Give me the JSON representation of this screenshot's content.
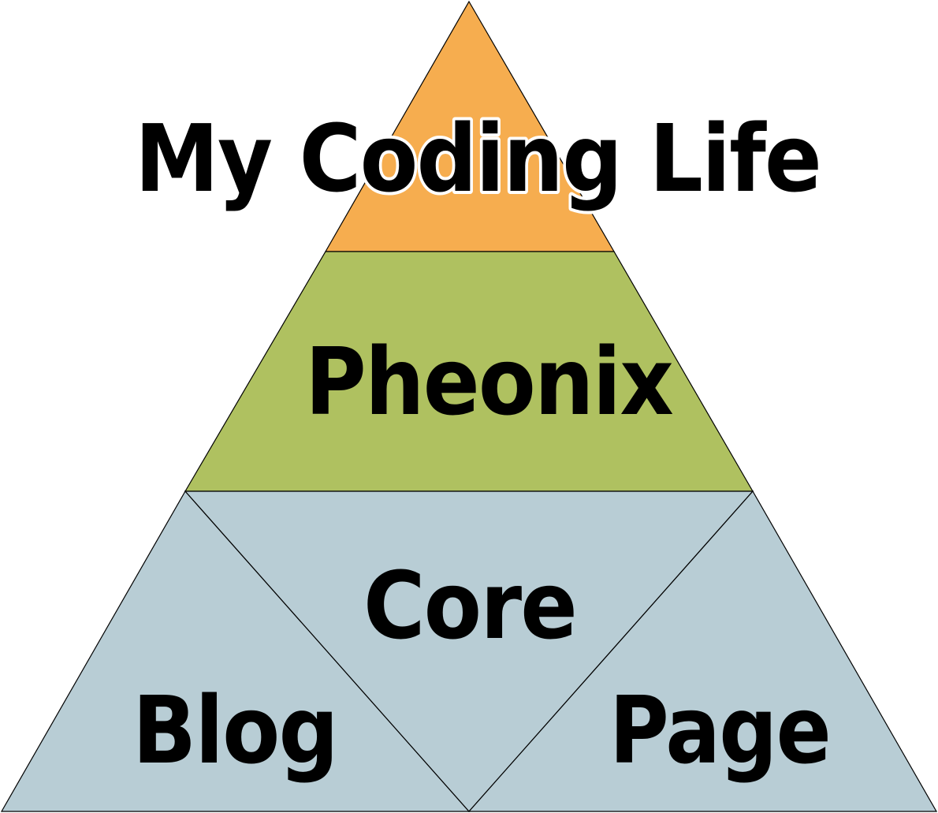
{
  "diagram": {
    "title": "My Coding Life",
    "layers": [
      {
        "label": "Pheonix",
        "color": "#AFC160"
      },
      {
        "label": "Core",
        "color": "#B8CDD5"
      }
    ],
    "bottom_sections": [
      {
        "label": "Blog",
        "color": "#B8CDD5"
      },
      {
        "label": "Page",
        "color": "#B8CDD5"
      }
    ],
    "apex_color": "#F6AD4F",
    "outline_color": "#000000"
  }
}
